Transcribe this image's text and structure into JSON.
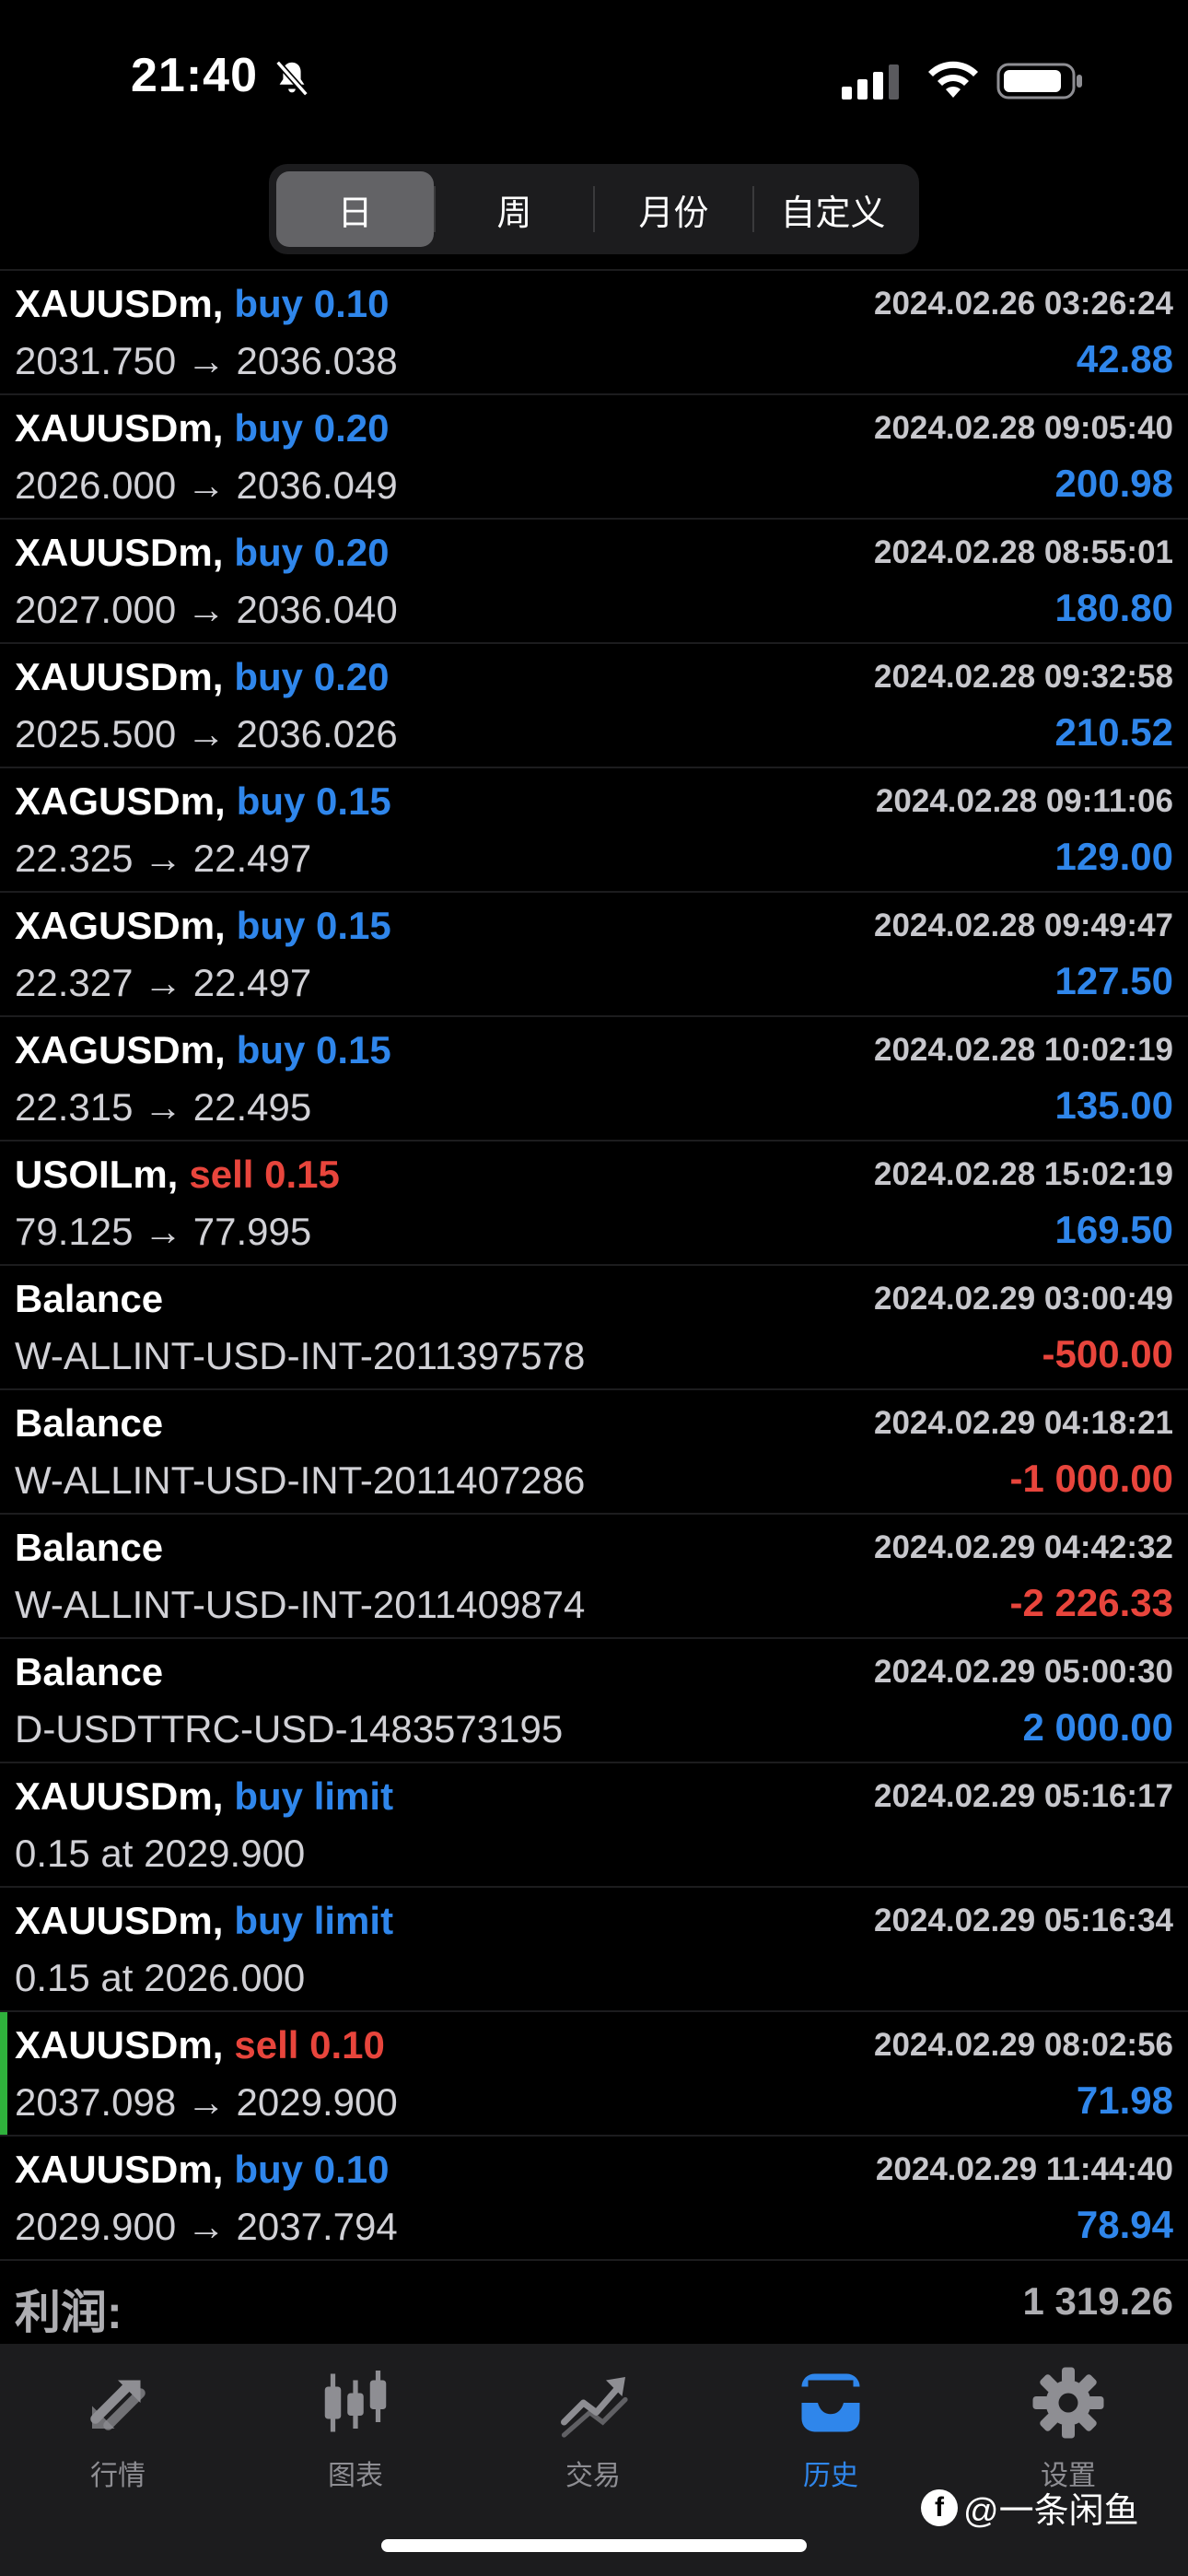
{
  "status_bar": {
    "time": "21:40"
  },
  "period_tabs": [
    {
      "label": "日",
      "active": true
    },
    {
      "label": "周",
      "active": false
    },
    {
      "label": "月份",
      "active": false
    },
    {
      "label": "自定义",
      "active": false
    }
  ],
  "records": [
    {
      "symbol": "XAUUSDm,",
      "side": "buy 0.10",
      "side_type": "buy",
      "datetime": "2024.02.26 03:26:24",
      "detail": "2031.750 → 2036.038",
      "profit": "42.88",
      "profit_sign": "pos",
      "marked": false
    },
    {
      "symbol": "XAUUSDm,",
      "side": "buy 0.20",
      "side_type": "buy",
      "datetime": "2024.02.28 09:05:40",
      "detail": "2026.000 → 2036.049",
      "profit": "200.98",
      "profit_sign": "pos",
      "marked": false
    },
    {
      "symbol": "XAUUSDm,",
      "side": "buy 0.20",
      "side_type": "buy",
      "datetime": "2024.02.28 08:55:01",
      "detail": "2027.000 → 2036.040",
      "profit": "180.80",
      "profit_sign": "pos",
      "marked": false
    },
    {
      "symbol": "XAUUSDm,",
      "side": "buy 0.20",
      "side_type": "buy",
      "datetime": "2024.02.28 09:32:58",
      "detail": "2025.500 → 2036.026",
      "profit": "210.52",
      "profit_sign": "pos",
      "marked": false
    },
    {
      "symbol": "XAGUSDm,",
      "side": "buy 0.15",
      "side_type": "buy",
      "datetime": "2024.02.28 09:11:06",
      "detail": "22.325 → 22.497",
      "profit": "129.00",
      "profit_sign": "pos",
      "marked": false
    },
    {
      "symbol": "XAGUSDm,",
      "side": "buy 0.15",
      "side_type": "buy",
      "datetime": "2024.02.28 09:49:47",
      "detail": "22.327 → 22.497",
      "profit": "127.50",
      "profit_sign": "pos",
      "marked": false
    },
    {
      "symbol": "XAGUSDm,",
      "side": "buy 0.15",
      "side_type": "buy",
      "datetime": "2024.02.28 10:02:19",
      "detail": "22.315 → 22.495",
      "profit": "135.00",
      "profit_sign": "pos",
      "marked": false
    },
    {
      "symbol": "USOILm,",
      "side": "sell 0.15",
      "side_type": "sell",
      "datetime": "2024.02.28 15:02:19",
      "detail": "79.125 → 77.995",
      "profit": "169.50",
      "profit_sign": "pos",
      "marked": false
    },
    {
      "symbol": "Balance",
      "side": "",
      "side_type": "",
      "datetime": "2024.02.29 03:00:49",
      "detail": "W-ALLINT-USD-INT-2011397578",
      "profit": "-500.00",
      "profit_sign": "neg",
      "marked": false
    },
    {
      "symbol": "Balance",
      "side": "",
      "side_type": "",
      "datetime": "2024.02.29 04:18:21",
      "detail": "W-ALLINT-USD-INT-2011407286",
      "profit": "-1 000.00",
      "profit_sign": "neg",
      "marked": false
    },
    {
      "symbol": "Balance",
      "side": "",
      "side_type": "",
      "datetime": "2024.02.29 04:42:32",
      "detail": "W-ALLINT-USD-INT-2011409874",
      "profit": "-2 226.33",
      "profit_sign": "neg",
      "marked": false
    },
    {
      "symbol": "Balance",
      "side": "",
      "side_type": "",
      "datetime": "2024.02.29 05:00:30",
      "detail": "D-USDTTRC-USD-1483573195",
      "profit": "2 000.00",
      "profit_sign": "pos",
      "marked": false
    },
    {
      "symbol": "XAUUSDm,",
      "side": "buy limit",
      "side_type": "buy",
      "datetime": "2024.02.29 05:16:17",
      "detail": "0.15 at 2029.900",
      "profit": "",
      "profit_sign": "pos",
      "marked": false
    },
    {
      "symbol": "XAUUSDm,",
      "side": "buy limit",
      "side_type": "buy",
      "datetime": "2024.02.29 05:16:34",
      "detail": "0.15 at 2026.000",
      "profit": "",
      "profit_sign": "pos",
      "marked": false
    },
    {
      "symbol": "XAUUSDm,",
      "side": "sell 0.10",
      "side_type": "sell",
      "datetime": "2024.02.29 08:02:56",
      "detail": "2037.098 → 2029.900",
      "profit": "71.98",
      "profit_sign": "pos",
      "marked": true
    },
    {
      "symbol": "XAUUSDm,",
      "side": "buy 0.10",
      "side_type": "buy",
      "datetime": "2024.02.29 11:44:40",
      "detail": "2029.900 → 2037.794",
      "profit": "78.94",
      "profit_sign": "pos",
      "marked": false
    }
  ],
  "summary": {
    "label": "利润:",
    "value": "1 319.26"
  },
  "tab_bar": [
    {
      "label": "行情",
      "icon": "arrows-icon",
      "active": false
    },
    {
      "label": "图表",
      "icon": "candlestick-icon",
      "active": false
    },
    {
      "label": "交易",
      "icon": "trend-icon",
      "active": false
    },
    {
      "label": "历史",
      "icon": "inbox-icon",
      "active": true
    },
    {
      "label": "设置",
      "icon": "gear-icon",
      "active": false
    }
  ],
  "watermark": {
    "text": "@一条闲鱼",
    "logo_letter": "f"
  },
  "colors": {
    "buy": "#2f86eb",
    "sell": "#e8453c",
    "marker": "#2fb13c",
    "active_tab": "#2f86eb"
  }
}
